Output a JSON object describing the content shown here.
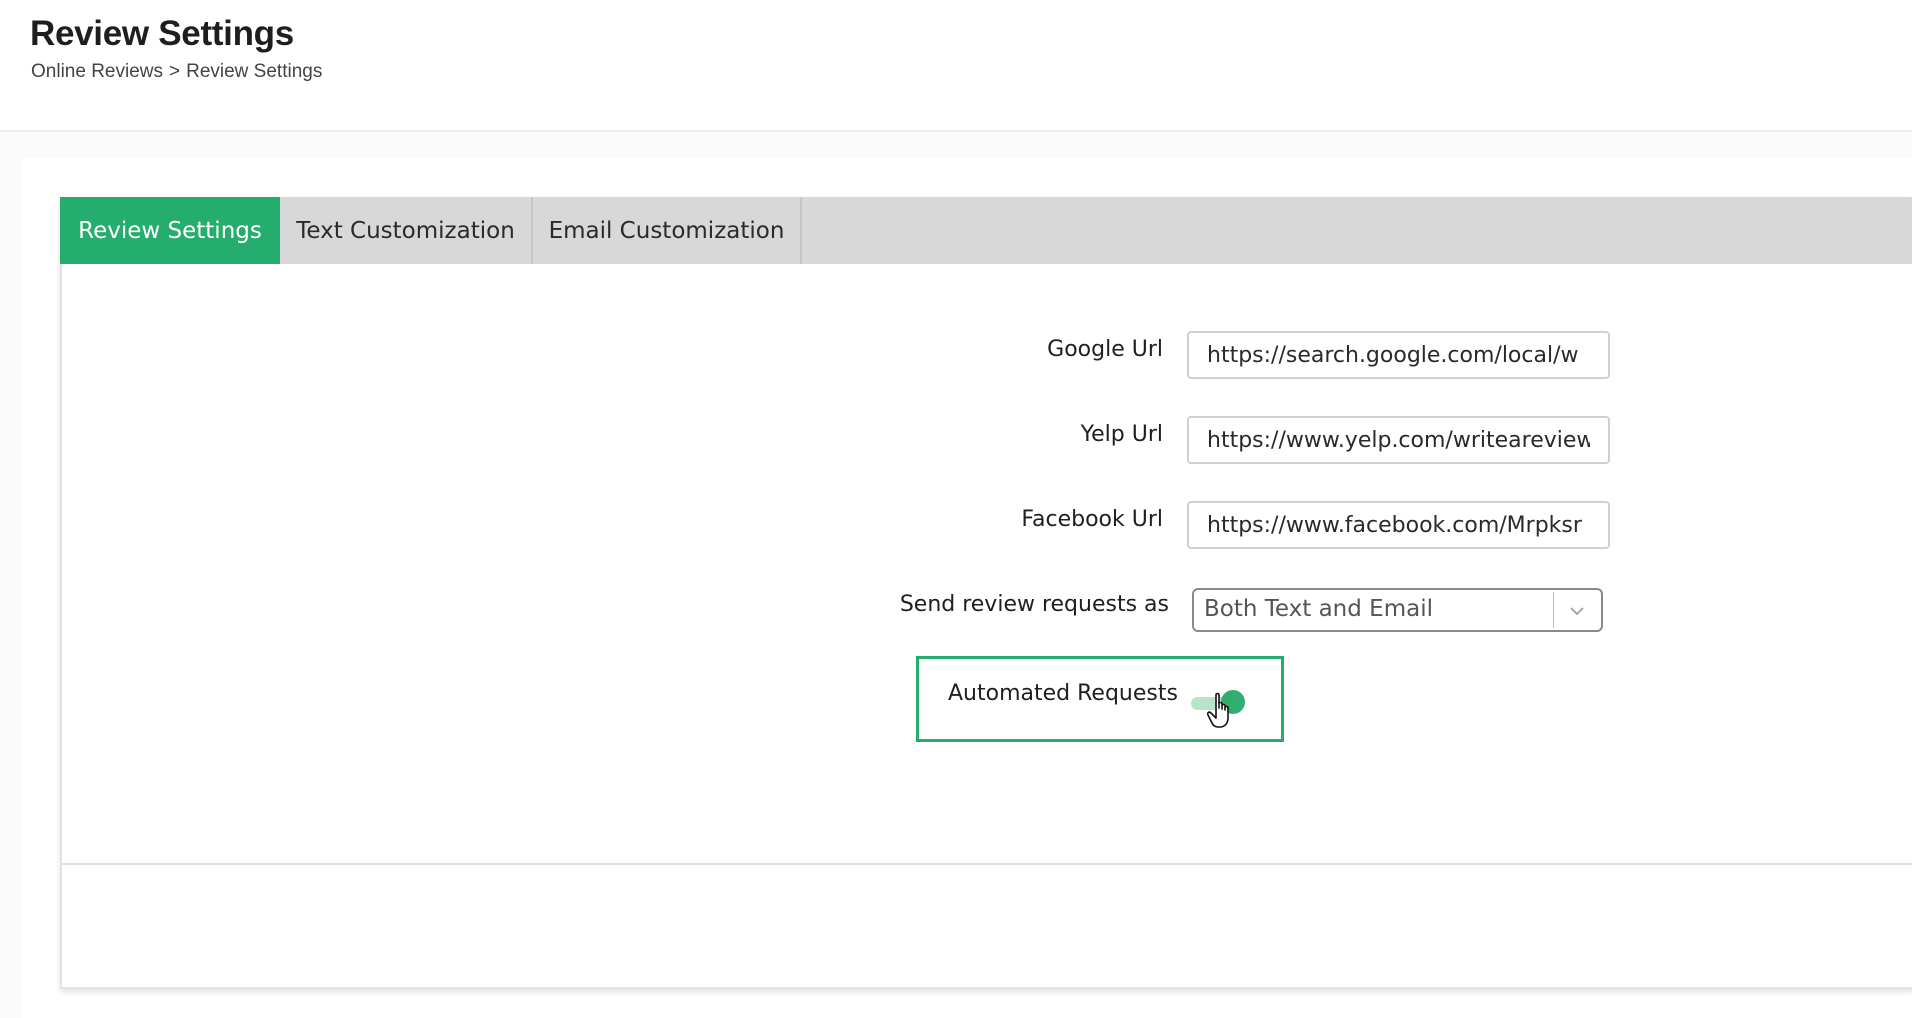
{
  "header": {
    "title": "Review Settings",
    "breadcrumb": {
      "parent": "Online Reviews",
      "separator": ">",
      "current": "Review Settings"
    }
  },
  "tabs": [
    {
      "label": "Review Settings",
      "active": true
    },
    {
      "label": "Text Customization",
      "active": false
    },
    {
      "label": "Email Customization",
      "active": false
    }
  ],
  "form": {
    "google_url": {
      "label": "Google Url",
      "value": "https://search.google.com/local/w"
    },
    "yelp_url": {
      "label": "Yelp Url",
      "value": "https://www.yelp.com/writeareview"
    },
    "facebook_url": {
      "label": "Facebook Url",
      "value": "https://www.facebook.com/Mrpksr"
    },
    "send_as": {
      "label": "Send review requests as",
      "selected": "Both Text and Email"
    },
    "automated_requests": {
      "label": "Automated Requests",
      "enabled": true
    }
  },
  "colors": {
    "accent": "#24ad6c",
    "tab_bar": "#d8d8d8",
    "toggle_track": "#b7e3c9",
    "toggle_knob": "#2fae6e"
  },
  "icons": {
    "select_arrow": "chevron-down-icon",
    "cursor": "hand-pointer-icon"
  }
}
